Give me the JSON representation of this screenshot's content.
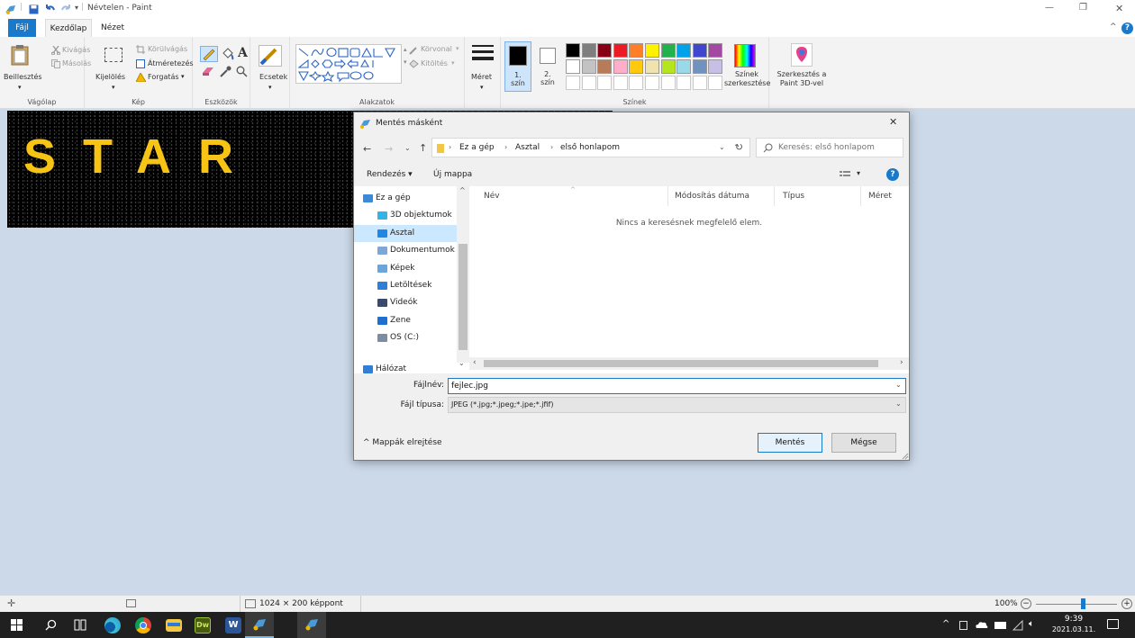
{
  "titlebar": {
    "title": "Névtelen - Paint",
    "controls": {
      "minimize": "—",
      "restore": "❐",
      "close": "✕"
    }
  },
  "menu": {
    "tabs": [
      "Fájl",
      "Kezdőlap",
      "Nézet"
    ],
    "help_symbol": "?"
  },
  "ribbon": {
    "clipboard": {
      "paste": "Beillesztés",
      "cut": "Kivágás",
      "copy": "Másolás",
      "label": "Vágólap"
    },
    "image": {
      "select": "Kijelölés",
      "crop": "Körülvágás",
      "resize": "Átméretezés",
      "rotate": "Forgatás",
      "label": "Kép"
    },
    "tools": {
      "label": "Eszközök",
      "text_glyph": "A"
    },
    "brushes": {
      "label": "Ecsetek"
    },
    "shapes": {
      "outline": "Körvonal",
      "fill": "Kitöltés",
      "label": "Alakzatok"
    },
    "size": {
      "label": "Méret"
    },
    "colors": {
      "color1": "1.\nszín",
      "color2": "2.\nszín",
      "edit": "Színek szerkesztése",
      "label": "Színek",
      "palette_row1": [
        "#000000",
        "#7f7f7f",
        "#880015",
        "#ed1c24",
        "#ff7f27",
        "#fff200",
        "#22b14c",
        "#00a2e8",
        "#3f48cc",
        "#a349a4"
      ],
      "palette_row2": [
        "#ffffff",
        "#c3c3c3",
        "#b97a57",
        "#ffaec9",
        "#ffc90e",
        "#efe4b0",
        "#b5e61d",
        "#99d9ea",
        "#7092be",
        "#c8bfe7"
      ]
    },
    "paint3d": {
      "label": "Szerkesztés a Paint 3D-vel"
    }
  },
  "canvas": {
    "text": "STAR"
  },
  "dialog": {
    "title": "Mentés másként",
    "close": "✕",
    "path": [
      "Ez a gép",
      "Asztal",
      "első honlapom"
    ],
    "search_placeholder": "Keresés: első honlapom",
    "toolbar": {
      "organize": "Rendezés ▾",
      "new_folder": "Új mappa",
      "help": "?"
    },
    "nav": [
      {
        "label": "Ez a gép",
        "icon": "computer-icon"
      },
      {
        "label": "3D objektumok",
        "icon": "cube-icon"
      },
      {
        "label": "Asztal",
        "icon": "desktop-icon",
        "selected": true
      },
      {
        "label": "Dokumentumok",
        "icon": "document-icon"
      },
      {
        "label": "Képek",
        "icon": "pictures-icon"
      },
      {
        "label": "Letöltések",
        "icon": "download-icon"
      },
      {
        "label": "Videók",
        "icon": "video-icon"
      },
      {
        "label": "Zene",
        "icon": "music-icon"
      },
      {
        "label": "OS (C:)",
        "icon": "drive-icon"
      },
      {
        "label": "Hálózat",
        "icon": "network-icon"
      }
    ],
    "columns": [
      "Név",
      "Módosítás dátuma",
      "Típus",
      "Méret"
    ],
    "empty_message": "Nincs a keresésnek megfelelő elem.",
    "filename_label": "Fájlnév:",
    "filename_value": "fejlec.jpg",
    "filetype_label": "Fájl típusa:",
    "filetype_value": "JPEG (*.jpg;*.jpeg;*.jpe;*.jfif)",
    "hide_folders": "Mappák elrejtése",
    "save": "Mentés",
    "cancel": "Mégse"
  },
  "status": {
    "dimensions": "1024 × 200 képpont",
    "zoom": "100%"
  },
  "taskbar": {
    "time": "9:39",
    "date": "2021.03.11."
  },
  "colors": {
    "accent": "#1979ca",
    "star_yellow": "#f7c315",
    "canvas_bg": "#ccd9e9"
  }
}
